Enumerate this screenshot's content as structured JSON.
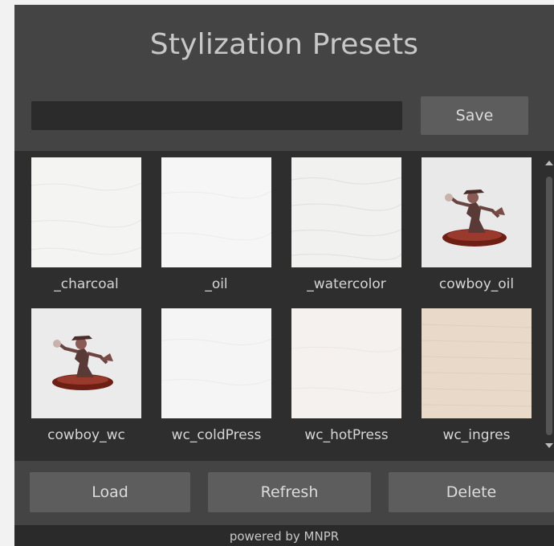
{
  "panel": {
    "title": "Stylization Presets",
    "preset_name_value": "",
    "save_label": "Save"
  },
  "presets": [
    {
      "label": "_charcoal",
      "thumb_color": "#f4f4f2",
      "icon": "paper-texture-icon"
    },
    {
      "label": "_oil",
      "thumb_color": "#f6f6f6",
      "icon": "paper-texture-icon"
    },
    {
      "label": "_watercolor",
      "thumb_color": "#f1f1ef",
      "icon": "paper-texture-icon"
    },
    {
      "label": "cowboy_oil",
      "thumb_color": "#e9e9e9",
      "icon": "cowboy-figure-icon"
    },
    {
      "label": "cowboy_wc",
      "thumb_color": "#ebebeb",
      "icon": "cowboy-figure-icon"
    },
    {
      "label": "wc_coldPress",
      "thumb_color": "#f5f5f5",
      "icon": "paper-texture-icon"
    },
    {
      "label": "wc_hotPress",
      "thumb_color": "#f5f1ee",
      "icon": "paper-texture-icon"
    },
    {
      "label": "wc_ingres",
      "thumb_color": "#e8d9c8",
      "icon": "paper-texture-icon"
    }
  ],
  "actions": {
    "load_label": "Load",
    "refresh_label": "Refresh",
    "delete_label": "Delete"
  },
  "footer": {
    "text": "powered by MNPR"
  },
  "colors": {
    "panel_bg": "#444444",
    "grid_bg": "#2e2e2e",
    "button_bg": "#5d5d5d",
    "text": "#d6d6d6"
  }
}
